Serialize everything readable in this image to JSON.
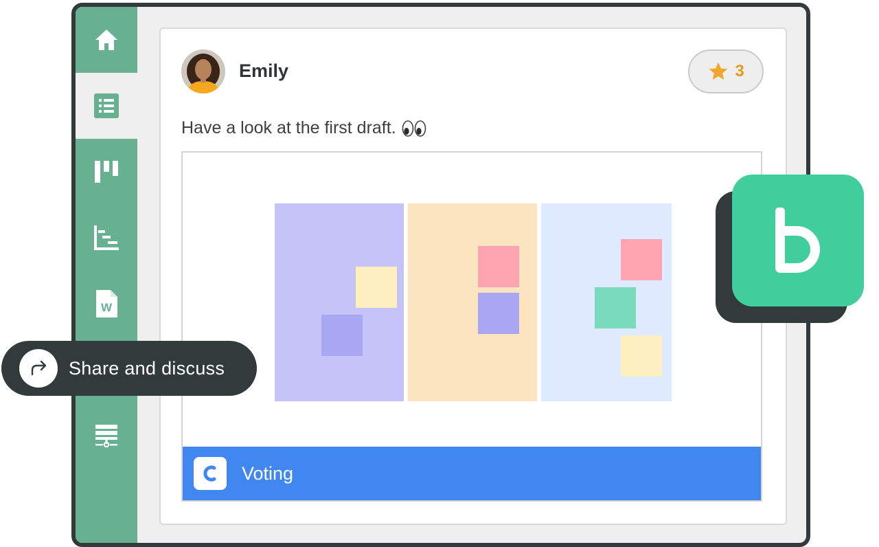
{
  "sidebar": {
    "items": [
      {
        "icon": "home-icon",
        "active": false
      },
      {
        "icon": "list-icon",
        "active": true
      },
      {
        "icon": "kanban-icon",
        "active": false
      },
      {
        "icon": "gantt-icon",
        "active": false
      },
      {
        "icon": "word-document-icon",
        "active": false
      },
      {
        "icon": "sitemap-icon",
        "active": false
      }
    ]
  },
  "post": {
    "author": "Emily",
    "star_count": "3",
    "message": "Have a look at the first draft.",
    "message_emoji": "eyes-emoji"
  },
  "attachment": {
    "label": "Voting",
    "icon": "voting-app-icon"
  },
  "share": {
    "label": "Share and discuss",
    "icon": "share-arrow-icon"
  },
  "app_badge": {
    "icon": "app-logo-icon"
  },
  "colors": {
    "sidebar": "#68b092",
    "frame": "#323a3c",
    "attachment_bar": "#4088ef",
    "star": "#e59b1c",
    "app_tile": "#42cd9d",
    "column_purple": "#c5c3f8",
    "column_orange": "#fbe4bf",
    "column_blue": "#deeafd",
    "note_yellow": "#fdefc0",
    "note_purple": "#aaa7f2",
    "note_pink": "#fda4b1",
    "note_green": "#79dbbc"
  }
}
